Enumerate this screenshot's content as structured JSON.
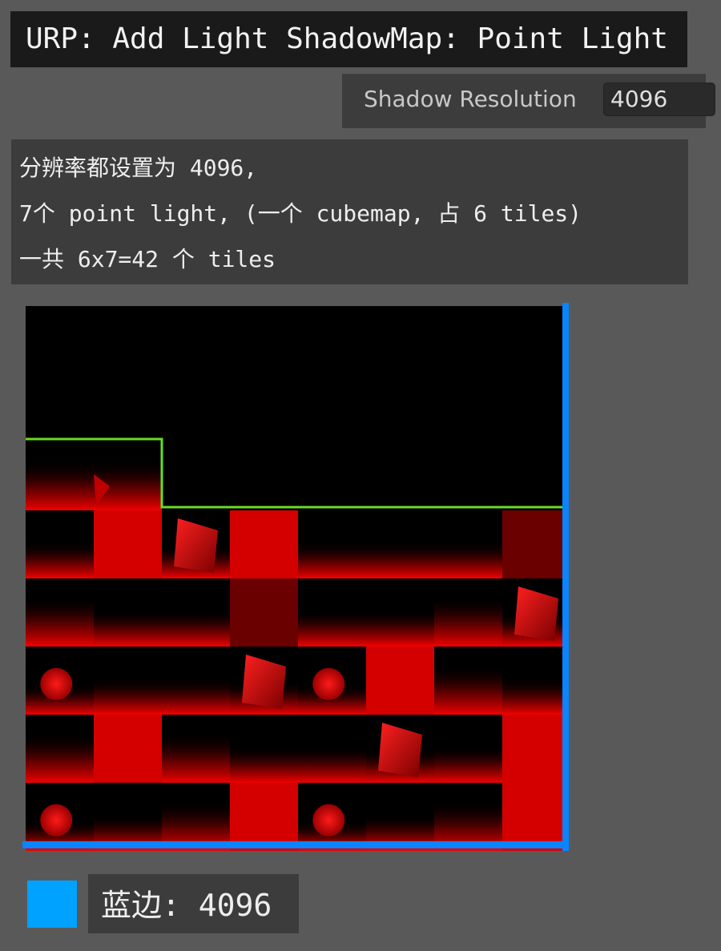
{
  "title": "URP: Add Light ShadowMap: Point Light",
  "setting": {
    "label": "Shadow Resolution",
    "value": "4096"
  },
  "notes": [
    "分辨率都设置为 4096,",
    "7个 point light, (一个 cubemap, 占 6 tiles)",
    "一共 6x7=42 个 tiles"
  ],
  "atlas": {
    "resolution": 4096,
    "grid_columns": 8,
    "grid_rows": 8,
    "point_lights": 7,
    "tiles_per_light": 6,
    "total_tiles": 42,
    "colors": {
      "background": "#000000",
      "shadow": "#ff0000",
      "allocated_outline": "#66dd22",
      "resolution_border": "#0a84ff"
    }
  },
  "legend": {
    "swatch_color": "#00a2ff",
    "label": "蓝边: 4096"
  }
}
